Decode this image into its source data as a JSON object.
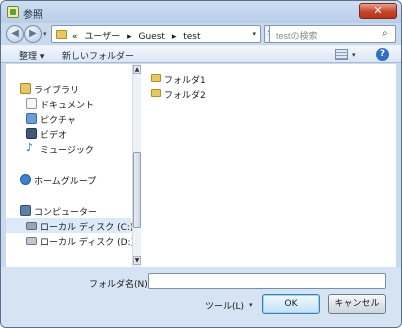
{
  "window": {
    "title": "参照",
    "close_label": "✕"
  },
  "address": {
    "back_icon": "arrow-left-icon",
    "forward_icon": "arrow-right-icon",
    "prefix": "«",
    "crumbs": [
      "ユーザー",
      "Guest",
      "test"
    ],
    "separator": "▸",
    "search_placeholder": "testの検索"
  },
  "toolbar": {
    "organize_label": "整理 ▾",
    "new_folder_label": "新しいフォルダー"
  },
  "nav": {
    "libraries": "ライブラリ",
    "documents": "ドキュメント",
    "pictures": "ピクチャ",
    "videos": "ビデオ",
    "music": "ミュージック",
    "homegroup": "ホームグループ",
    "computer": "コンピューター",
    "local_disk": "ローカル ディスク (C:)",
    "local_disk2": "ローカル ディスク (D:)"
  },
  "files": [
    {
      "name": "フォルダ1"
    },
    {
      "name": "フォルダ2"
    }
  ],
  "bottom": {
    "filename_label": "フォルダ名(N):",
    "filename_value": "",
    "tools_label": "ツール(L)",
    "ok_label": "OK",
    "cancel_label": "キャンセル"
  }
}
